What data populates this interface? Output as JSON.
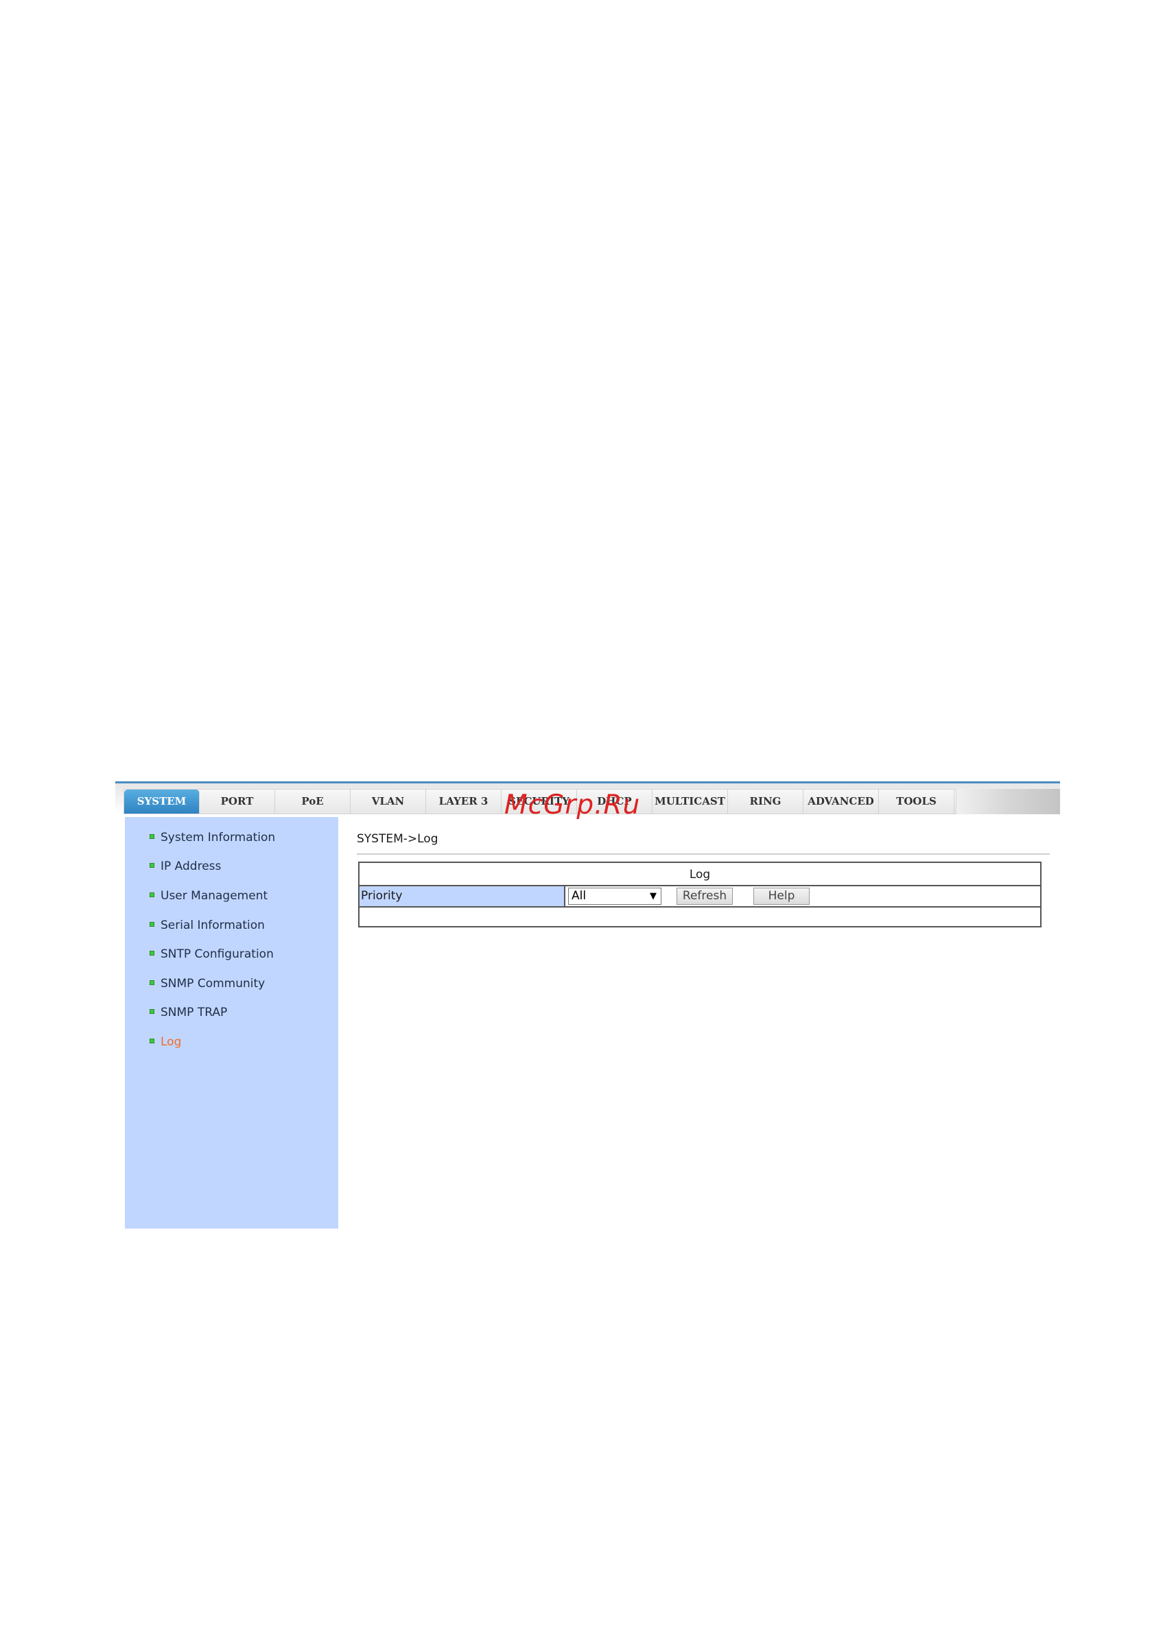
{
  "tabs": [
    {
      "label": "SYSTEM",
      "active": true
    },
    {
      "label": "PORT",
      "active": false
    },
    {
      "label": "PoE",
      "active": false
    },
    {
      "label": "VLAN",
      "active": false
    },
    {
      "label": "LAYER 3",
      "active": false
    },
    {
      "label": "SECURITY",
      "active": false
    },
    {
      "label": "DHCP",
      "active": false
    },
    {
      "label": "MULTICAST",
      "active": false
    },
    {
      "label": "RING",
      "active": false
    },
    {
      "label": "ADVANCED",
      "active": false
    },
    {
      "label": "TOOLS",
      "active": false
    }
  ],
  "watermark": "McGrp.Ru",
  "sidebar": {
    "items": [
      {
        "label": "System Information"
      },
      {
        "label": "IP Address"
      },
      {
        "label": "User Management"
      },
      {
        "label": "Serial Information"
      },
      {
        "label": "SNTP Configuration"
      },
      {
        "label": "SNMP Community"
      },
      {
        "label": "SNMP TRAP"
      },
      {
        "label": "Log",
        "active": true
      }
    ]
  },
  "breadcrumb": "SYSTEM->Log",
  "log_panel": {
    "title": "Log",
    "priority_label": "Priority",
    "priority_value": "All",
    "refresh_label": "Refresh",
    "help_label": "Help"
  },
  "colors": {
    "sidebar_bg": "#c1d6fe",
    "active_tab": "#3a92d0",
    "active_item": "#f26a2b",
    "bullet": "#3ec93e"
  }
}
